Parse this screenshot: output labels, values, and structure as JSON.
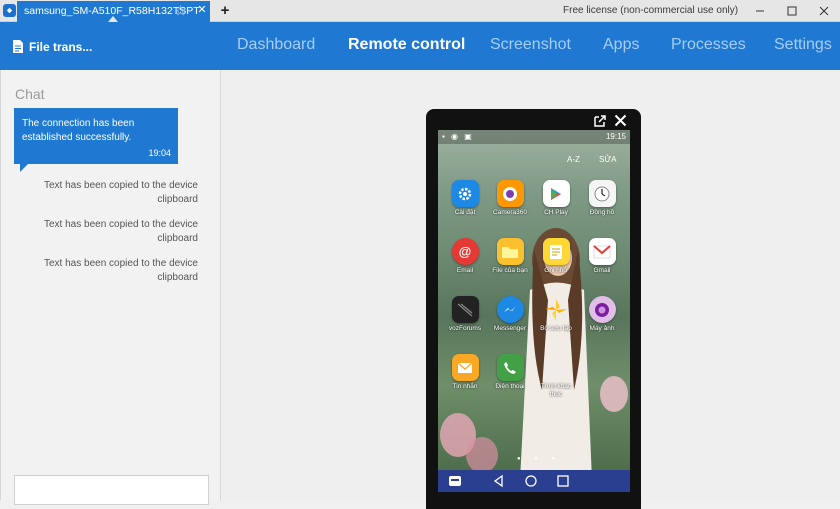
{
  "window": {
    "tab_title": "samsung_SM-A510F_R58H132TSPT",
    "license_text": "Free license (non-commercial use only)"
  },
  "toolbar": {
    "file_transfer_label": "File trans...",
    "nav": [
      "Dashboard",
      "Remote control",
      "Screenshot",
      "Apps",
      "Processes",
      "Settings"
    ],
    "active_nav": "Remote control"
  },
  "chat": {
    "title": "Chat",
    "incoming": {
      "text": "The connection has been established successfully.",
      "time": "19:04"
    },
    "messages": [
      "Text has been copied to the device clipboard",
      "Text has been copied to the device clipboard",
      "Text has been copied to the device clipboard"
    ]
  },
  "phone": {
    "status_time": "19:15",
    "sort_label": "A-Z",
    "edit_label": "SỬA",
    "apps": [
      {
        "label": "Cài đặt",
        "color": "#1e88e5",
        "icon": "gear-icon"
      },
      {
        "label": "Camera360",
        "color": "#ff9800",
        "icon": "camera-icon"
      },
      {
        "label": "CH Play",
        "color": "#ffffff",
        "icon": "play-store-icon"
      },
      {
        "label": "Đồng hồ",
        "color": "#f5f5f5",
        "icon": "clock-icon"
      },
      {
        "label": "Email",
        "color": "#e53935",
        "icon": "email-icon"
      },
      {
        "label": "File của bạn",
        "color": "#fbc02d",
        "icon": "folder-icon"
      },
      {
        "label": "Ghi nhớ",
        "color": "#fdd835",
        "icon": "memo-icon"
      },
      {
        "label": "Gmail",
        "color": "#ffffff",
        "icon": "gmail-icon"
      },
      {
        "label": "vozForums",
        "color": "#222222",
        "icon": "voz-icon"
      },
      {
        "label": "Messenger",
        "color": "#1e88e5",
        "icon": "messenger-icon"
      },
      {
        "label": "Bộ sưu tập",
        "color": "#ffca28",
        "icon": "gallery-icon"
      },
      {
        "label": "Máy ảnh",
        "color": "#9c27b0",
        "icon": "camera-lens-icon"
      },
      {
        "label": "Tin nhắn",
        "color": "#f9a825",
        "icon": "message-icon"
      },
      {
        "label": "Điện thoại",
        "color": "#43a047",
        "icon": "phone-icon"
      },
      {
        "label": "Trình khác thúc",
        "color": "#eeeeee",
        "icon": "browser-icon"
      }
    ]
  },
  "colors": {
    "brand": "#1f78d1",
    "nav_inactive": "#a8cdf2"
  }
}
